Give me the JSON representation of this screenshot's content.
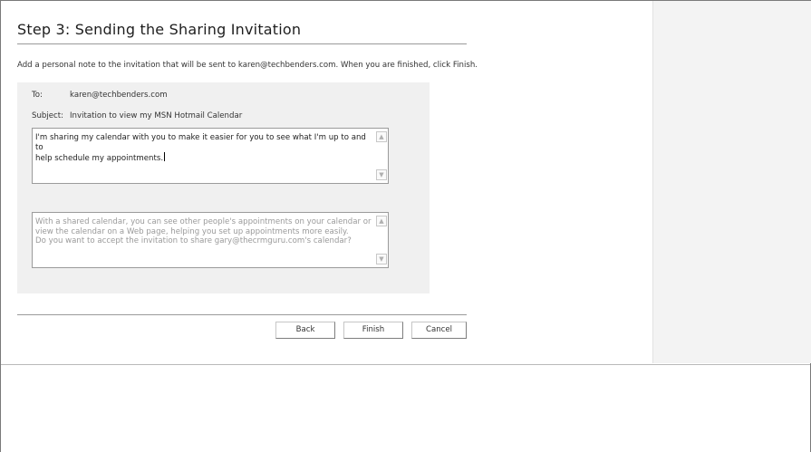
{
  "page": {
    "title": "Step 3: Sending the Sharing Invitation",
    "instructions": "Add a personal note to the invitation that will be sent to karen@techbenders.com. When you are finished, click Finish."
  },
  "form": {
    "to_label": "To:",
    "to_value": "karen@techbenders.com",
    "subject_label": "Subject:",
    "subject_value": "Invitation to view my MSN Hotmail Calendar",
    "note_lines": [
      "I'm sharing my calendar with you to make it easier for you to see what I'm up to and to",
      "help schedule my appointments."
    ],
    "info_lines": [
      "With a shared calendar, you can see other people's appointments on your calendar or",
      "view the calendar on a Web page, helping you set up appointments more easily.",
      "Do you want to accept the invitation to share gary@thecrmguru.com's calendar?"
    ]
  },
  "buttons": {
    "back": "Back",
    "finish": "Finish",
    "cancel": "Cancel"
  },
  "icons": {
    "scroll_up": "chevron-up-icon",
    "scroll_down": "chevron-down-icon"
  }
}
